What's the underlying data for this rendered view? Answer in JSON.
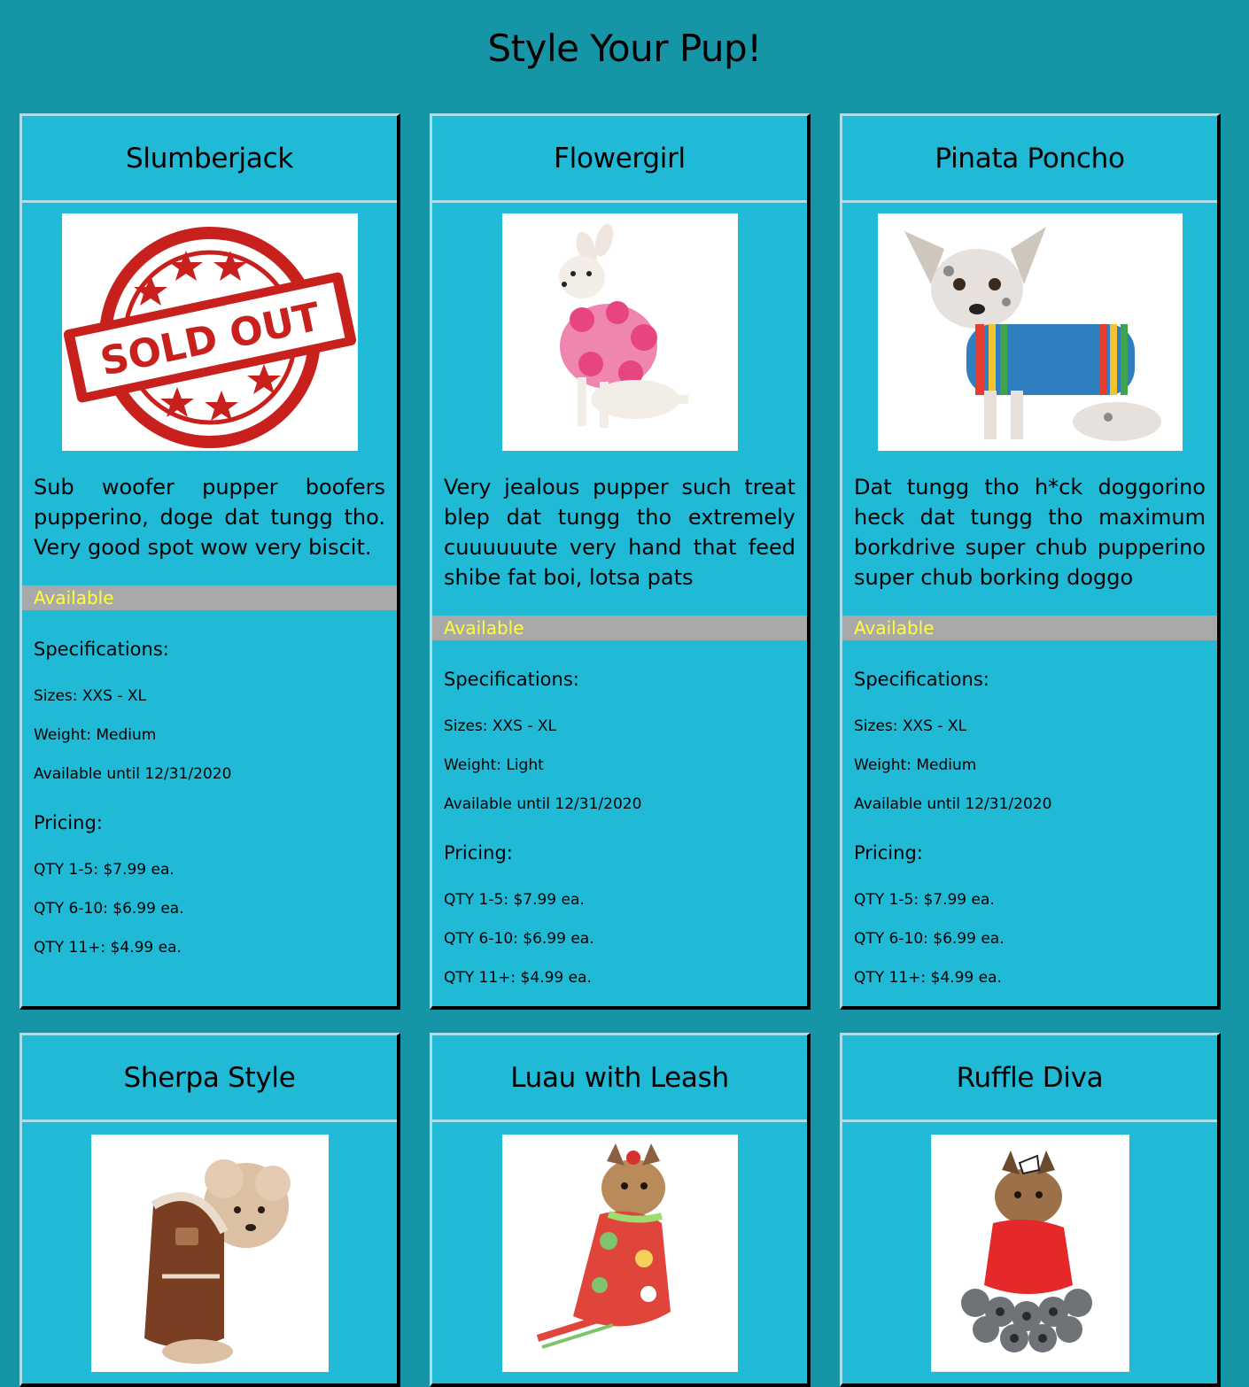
{
  "page": {
    "title": "Style Your Pup!"
  },
  "colors": {
    "background": "#1695a6",
    "card": "#20bad6",
    "availability_bar": "#a9a9a9",
    "availability_text": "#ffff33",
    "sold_out_red": "#c8201c"
  },
  "labels": {
    "specifications": "Specifications:",
    "pricing": "Pricing:"
  },
  "products": [
    {
      "name": "Slumberjack",
      "image": "sold-out-stamp",
      "stamp_text": "SOLD OUT",
      "description": "Sub woofer pupper boofers pupperino, doge dat tungg tho. Very good spot wow very biscit.",
      "availability": "Available",
      "sizes": "Sizes: XXS - XL",
      "weight": "Weight: Medium",
      "available_until": "Available until 12/31/2020",
      "pricing": [
        "QTY 1-5: $7.99 ea.",
        "QTY 6-10: $6.99 ea.",
        "QTY 11+: $4.99 ea."
      ]
    },
    {
      "name": "Flowergirl",
      "image": "chihuahua-pink-flower-dress-photo",
      "description": "Very jealous pupper such treat blep dat tungg tho extremely cuuuuuute very hand that feed shibe fat boi, lotsa pats",
      "availability": "Available",
      "sizes": "Sizes: XXS - XL",
      "weight": "Weight: Light",
      "available_until": "Available until 12/31/2020",
      "pricing": [
        "QTY 1-5: $7.99 ea.",
        "QTY 6-10: $6.99 ea.",
        "QTY 11+: $4.99 ea."
      ]
    },
    {
      "name": "Pinata Poncho",
      "image": "chihuahua-striped-poncho-photo",
      "description": "Dat tungg tho h*ck doggorino heck dat tungg tho maximum borkdrive super chub pupperino super chub borking doggo",
      "availability": "Available",
      "sizes": "Sizes: XXS - XL",
      "weight": "Weight: Medium",
      "available_until": "Available until 12/31/2020",
      "pricing": [
        "QTY 1-5: $7.99 ea.",
        "QTY 6-10: $6.99 ea.",
        "QTY 11+: $4.99 ea."
      ]
    },
    {
      "name": "Sherpa Style",
      "image": "poodle-brown-sherpa-coat-photo"
    },
    {
      "name": "Luau with Leash",
      "image": "yorkie-hawaiian-dress-photo"
    },
    {
      "name": "Ruffle Diva",
      "image": "yorkie-red-ruffle-dress-photo"
    }
  ]
}
